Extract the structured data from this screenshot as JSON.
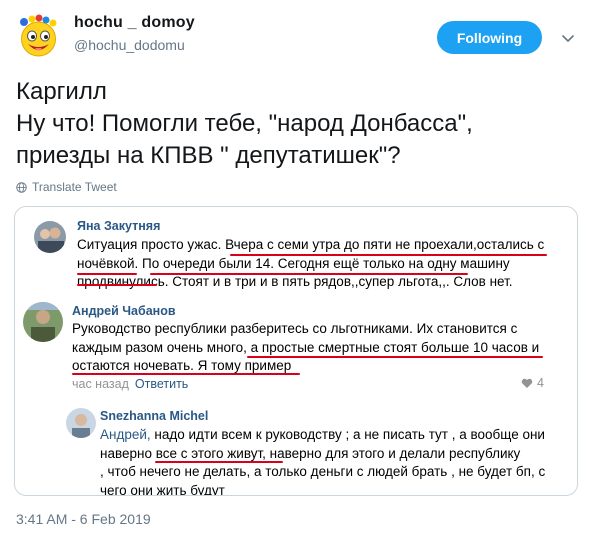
{
  "header": {
    "display_name": "hochu _ domoy",
    "handle": "@hochu_dodomu",
    "follow_label": "Following"
  },
  "tweet": {
    "lines": [
      "Каргилл",
      "Ну что! Помогли тебе, \"народ Донбасса\",",
      "приезды на КПВВ \" депутатишек\"?"
    ],
    "translate_label": "Translate Tweet",
    "timestamp": "3:41 AM - 6 Feb 2019"
  },
  "embed": {
    "comments": [
      {
        "author": "Яна Закутняя",
        "lines": [
          "Ситуация просто ужас. Вчера с семи утра до пяти не проехали,остались с",
          "ночёвкой. По очереди были 14. Сегодня ещё только на одну машину",
          "продвинулись. Стоят и в три и в пять рядов,,супер льгота,,. Слов нет."
        ]
      },
      {
        "author": "Андрей Чабанов",
        "lines": [
          "Руководство республики разберитесь со льготниками. Их становится с",
          "каждым разом очень много, а простые смертные стоят больше 10 часов и",
          "остаются ночевать. Я тому пример"
        ],
        "time": "час назад",
        "reply_label": "Ответить",
        "likes": "4"
      },
      {
        "author": "Snezhanna Michel",
        "mention": "Андрей,",
        "lines": [
          " надо идти всем к руководству ; а не писать тут , а вообще они",
          "наверно все с этого живут, наверно для этого и делали республику",
          ", чтоб нечего не делать, а только деньги с людей брать , не будет бп, с",
          "чего они жить будут"
        ]
      }
    ]
  },
  "colors": {
    "follow_button": "#1da1f2",
    "link_blue": "#2a5885",
    "underline_red": "#d9001b",
    "muted": "#657786"
  },
  "icons": [
    "emoji-face-icon",
    "chevron-down-icon",
    "globe-icon",
    "heart-icon"
  ]
}
